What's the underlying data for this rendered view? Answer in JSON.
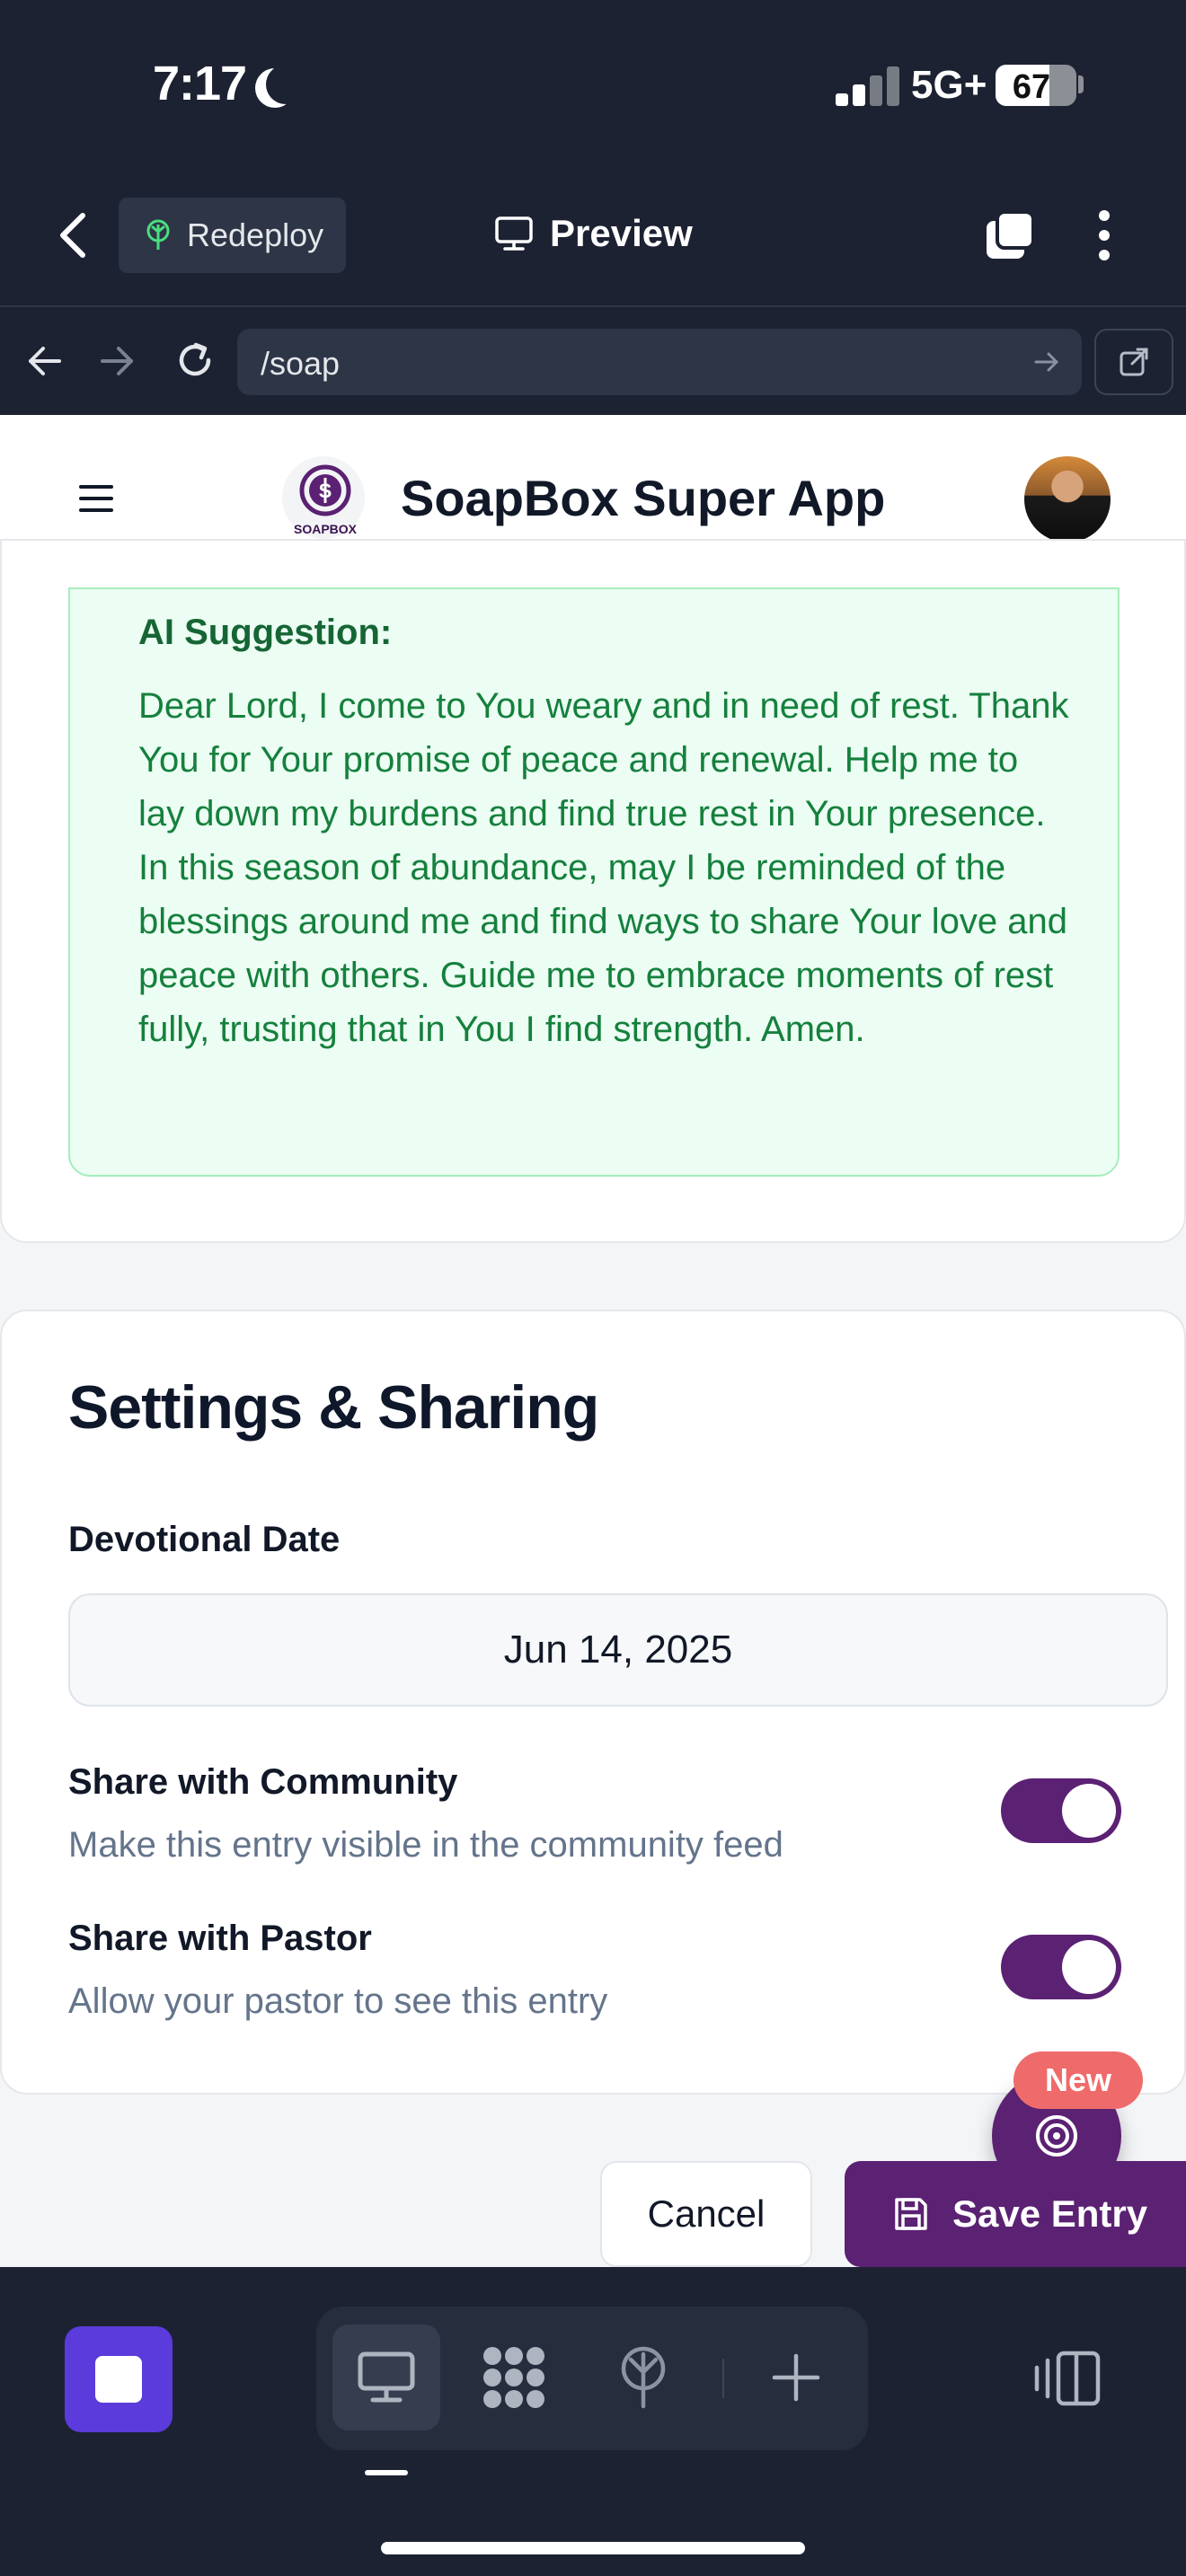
{
  "status_bar": {
    "time": "7:17",
    "network": "5G+",
    "battery": "67",
    "battery_level_percent": 67
  },
  "browser": {
    "redeploy_label": "Redeploy",
    "preview_label": "Preview",
    "url": "/soap"
  },
  "app": {
    "title": "SoapBox Super App",
    "logo_text": "SOAPBOX"
  },
  "ai_suggestion": {
    "label": "AI Suggestion:",
    "text": "Dear Lord, I come to You weary and in need of rest. Thank You for Your promise of peace and renewal. Help me to lay down my burdens and find true rest in Your presence. In this season of abundance, may I be reminded of the blessings around me and find ways to share Your love and peace with others. Guide me to embrace moments of rest fully, trusting that in You I find strength. Amen."
  },
  "settings": {
    "title": "Settings & Sharing",
    "date_label": "Devotional Date",
    "date_value": "Jun 14, 2025",
    "share_community": {
      "title": "Share with Community",
      "description": "Make this entry visible in the community feed",
      "enabled": true
    },
    "share_pastor": {
      "title": "Share with Pastor",
      "description": "Allow your pastor to see this entry",
      "enabled": true
    }
  },
  "fab": {
    "badge": "New",
    "icon": "target-icon"
  },
  "actions": {
    "cancel_label": "Cancel",
    "save_label": "Save Entry"
  },
  "colors": {
    "brand_purple": "#5b2173",
    "ai_green_text": "#15803d",
    "ai_green_bg": "#ecfdf3",
    "chrome_bg": "#1c2232",
    "badge_red": "#ef6b6b"
  }
}
